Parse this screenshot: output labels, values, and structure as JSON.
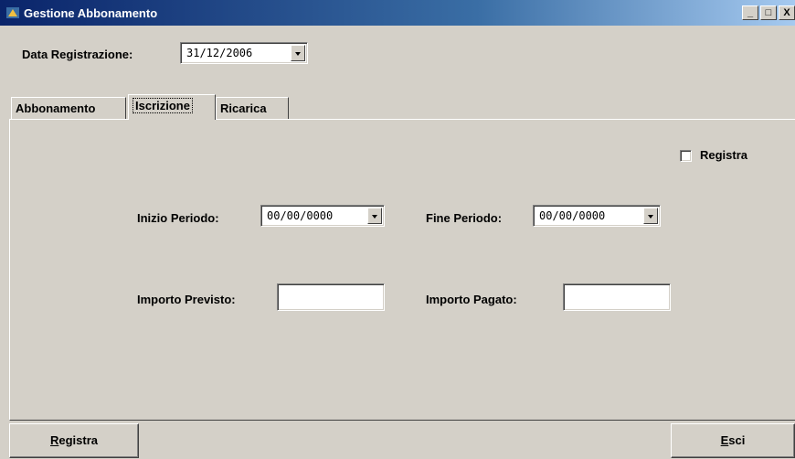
{
  "window": {
    "title": "Gestione Abbonamento",
    "controls": {
      "minimize": "_",
      "maximize": "□",
      "close": "X"
    }
  },
  "header": {
    "data_registrazione_label": "Data Registrazione:",
    "data_registrazione_value": "31/12/2006"
  },
  "tabs": [
    {
      "label": "Abbonamento",
      "active": false
    },
    {
      "label": "Iscrizione",
      "active": true
    },
    {
      "label": "Ricarica",
      "active": false
    }
  ],
  "panel": {
    "registra_checkbox_label": "Registra",
    "registra_checked": false,
    "inizio_periodo_label": "Inizio Periodo:",
    "inizio_periodo_value": "00/00/0000",
    "fine_periodo_label": "Fine Periodo:",
    "fine_periodo_value": "00/00/0000",
    "importo_previsto_label": "Importo Previsto:",
    "importo_previsto_value": "",
    "importo_pagato_label": "Importo Pagato:",
    "importo_pagato_value": ""
  },
  "footer": {
    "registra_button": {
      "mnemonic": "R",
      "rest": "egistra"
    },
    "esci_button": {
      "mnemonic": "E",
      "rest": "sci"
    }
  },
  "icons": {
    "app": "app-icon",
    "dropdown": "chevron-down-icon"
  },
  "colors": {
    "face": "#d4d0c8",
    "titlebar_start": "#0a246a",
    "titlebar_end": "#a6caf0"
  }
}
